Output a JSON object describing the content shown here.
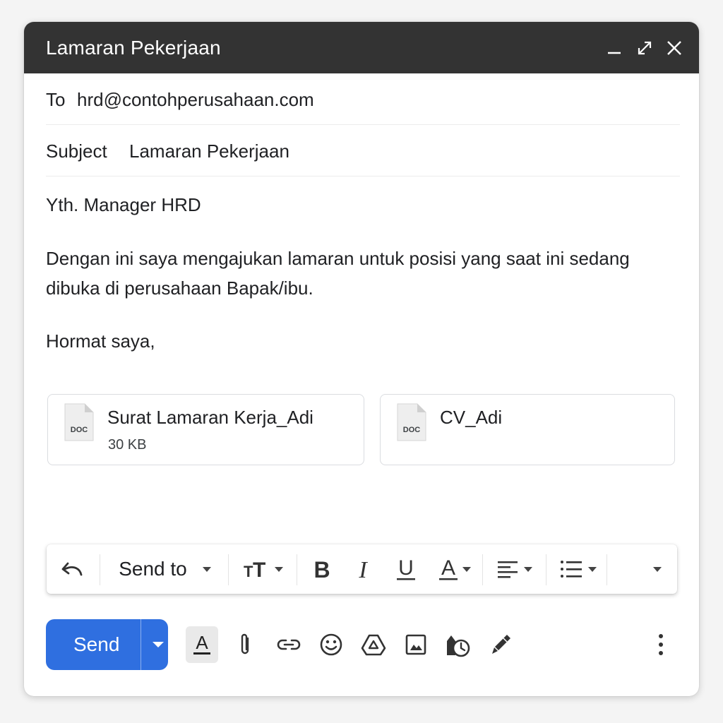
{
  "window": {
    "title": "Lamaran Pekerjaan"
  },
  "header": {
    "to_label": "To",
    "to_value": "hrd@contohperusahaan.com",
    "subject_label": "Subject",
    "subject_value": "Lamaran Pekerjaan"
  },
  "body": {
    "greeting": "Yth. Manager HRD",
    "paragraph_line1": "Dengan ini saya mengajukan lamaran untuk posisi yang saat ini sedang",
    "paragraph_line2": "dibuka di perusahaan Bapak/ibu.",
    "closing": "Hormat saya,"
  },
  "attachments": [
    {
      "name": "Surat Lamaran Kerja_Adi",
      "size": "30 KB",
      "type_label": "DOC"
    },
    {
      "name": "CV_Adi",
      "size": "",
      "type_label": "DOC"
    }
  ],
  "format_toolbar": {
    "send_to_label": "Send to",
    "items": [
      "undo-icon",
      "send-to-dropdown",
      "text-size-icon",
      "bold-icon",
      "italic-icon",
      "underline-icon",
      "text-color-icon",
      "align-icon",
      "numbered-list-icon",
      "more-formatting-icon"
    ]
  },
  "actions": {
    "send_label": "Send",
    "icons": [
      "formatting-options-icon",
      "attach-icon",
      "link-icon",
      "emoji-icon",
      "drive-icon",
      "photo-icon",
      "schedule-send-icon",
      "signature-icon",
      "more-options-icon"
    ]
  },
  "colors": {
    "title_bar": "#333333",
    "send_button": "#2f6fe0",
    "background": "#f4f4f4"
  }
}
